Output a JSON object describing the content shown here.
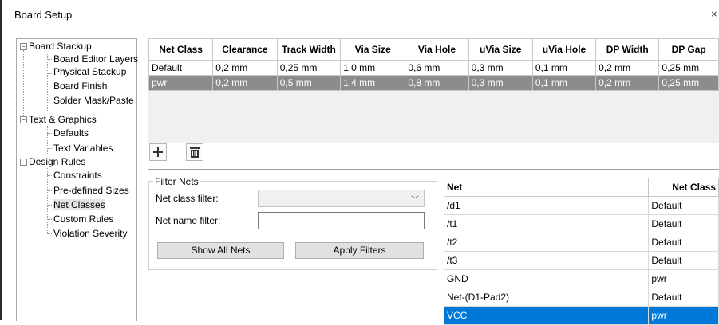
{
  "window": {
    "title": "Board Setup",
    "close_label": "×"
  },
  "tree": {
    "groups": [
      {
        "label": "Board Stackup",
        "items": [
          "Board Editor Layers",
          "Physical Stackup",
          "Board Finish",
          "Solder Mask/Paste"
        ]
      },
      {
        "label": "Text & Graphics",
        "items": [
          "Defaults",
          "Text Variables"
        ]
      },
      {
        "label": "Design Rules",
        "items": [
          "Constraints",
          "Pre-defined Sizes",
          "Net Classes",
          "Custom Rules",
          "Violation Severity"
        ]
      }
    ],
    "selected": "Net Classes"
  },
  "netclasses": {
    "columns": [
      "Net Class",
      "Clearance",
      "Track Width",
      "Via Size",
      "Via Hole",
      "uVia Size",
      "uVia Hole",
      "DP Width",
      "DP Gap"
    ],
    "rows": [
      [
        "Default",
        "0,2 mm",
        "0,25 mm",
        "1,0 mm",
        "0,6 mm",
        "0,3 mm",
        "0,1 mm",
        "0,2 mm",
        "0,25 mm"
      ],
      [
        "pwr",
        "0,2 mm",
        "0,5 mm",
        "1,4 mm",
        "0,8 mm",
        "0,3 mm",
        "0,1 mm",
        "0,2 mm",
        "0,25 mm"
      ]
    ],
    "selected_row": 1
  },
  "toolbar": {
    "add_icon": "plus-icon",
    "delete_icon": "trash-icon"
  },
  "filter": {
    "group_title": "Filter Nets",
    "class_filter_label": "Net class filter:",
    "class_filter_value": "",
    "name_filter_label": "Net name filter:",
    "name_filter_value": "",
    "show_all_label": "Show All Nets",
    "apply_label": "Apply Filters"
  },
  "nets": {
    "columns": [
      "Net",
      "Net Class"
    ],
    "rows": [
      [
        "/d1",
        "Default"
      ],
      [
        "/t1",
        "Default"
      ],
      [
        "/t2",
        "Default"
      ],
      [
        "/t3",
        "Default"
      ],
      [
        "GND",
        "pwr"
      ],
      [
        "Net-(D1-Pad2)",
        "Default"
      ],
      [
        "VCC",
        "pwr"
      ]
    ],
    "selected_row": 6
  }
}
